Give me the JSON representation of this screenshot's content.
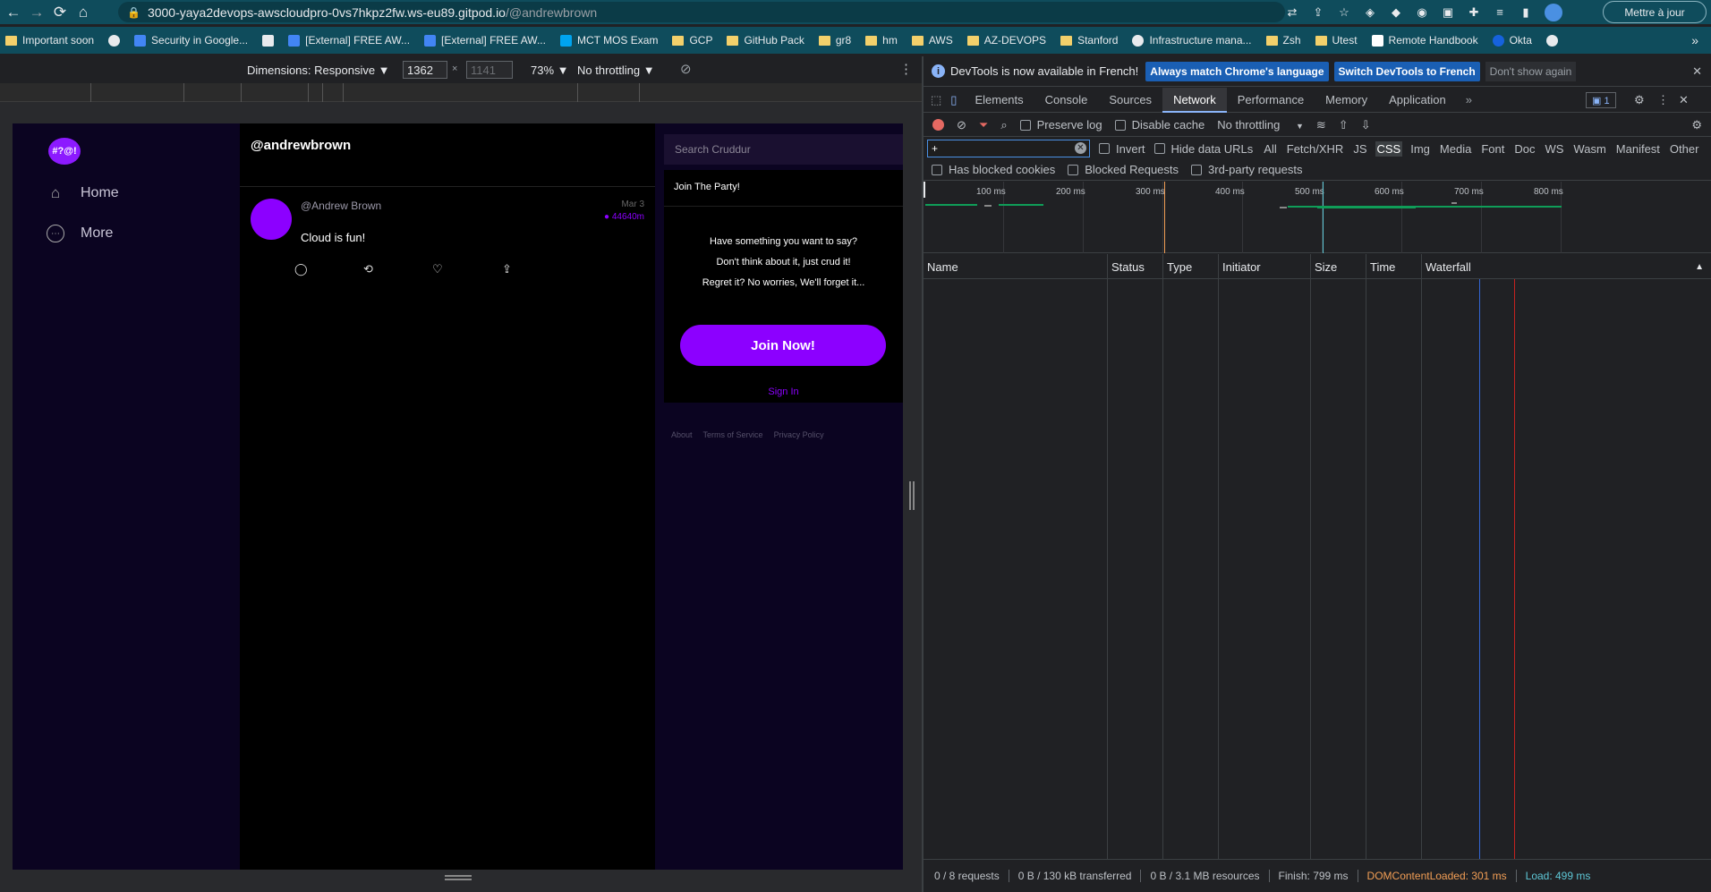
{
  "browser": {
    "url_host": "3000-yaya2devops-awscloudpro-0vs7hkpz2fw.ws-eu89.gitpod.io",
    "url_path": "/@andrewbrown",
    "update_button": "Mettre à jour",
    "bookmarks": [
      {
        "label": "Important soon",
        "icon": "folder"
      },
      {
        "label": "",
        "icon": "globe"
      },
      {
        "label": "Security in Google...",
        "icon": "gcloud"
      },
      {
        "label": "",
        "icon": "doc"
      },
      {
        "label": "[External] FREE AW...",
        "icon": "gdoc"
      },
      {
        "label": "[External] FREE AW...",
        "icon": "gdoc"
      },
      {
        "label": "MCT MOS Exam",
        "icon": "ms"
      },
      {
        "label": "GCP",
        "icon": "folder"
      },
      {
        "label": "GitHub Pack",
        "icon": "folder"
      },
      {
        "label": "gr8",
        "icon": "folder"
      },
      {
        "label": "hm",
        "icon": "folder"
      },
      {
        "label": "AWS",
        "icon": "folder"
      },
      {
        "label": "AZ-DEVOPS",
        "icon": "folder"
      },
      {
        "label": "Stanford",
        "icon": "folder"
      },
      {
        "label": "Infrastructure mana...",
        "icon": "globe"
      },
      {
        "label": "Zsh",
        "icon": "folder"
      },
      {
        "label": "Utest",
        "icon": "folder"
      },
      {
        "label": "Remote Handbook",
        "icon": "notion"
      },
      {
        "label": "Okta",
        "icon": "okta"
      },
      {
        "label": "",
        "icon": "github"
      }
    ],
    "bookmarks_more": "»"
  },
  "device_toolbar": {
    "dimensions_label": "Dimensions: Responsive ▼",
    "width": "1362",
    "height": "1141",
    "times": "×",
    "zoom": "73% ▼",
    "throttle": "No throttling ▼"
  },
  "app": {
    "logo_text": "#?@!",
    "nav": [
      {
        "label": "Home",
        "icon": "home-icon"
      },
      {
        "label": "More",
        "icon": "more-icon"
      }
    ],
    "feed_title": "@andrewbrown",
    "post": {
      "handle": "@Andrew Brown",
      "date": "Mar 3",
      "expiry": "44640m",
      "text": "Cloud is fun!"
    },
    "search_placeholder": "Search Cruddur",
    "join": {
      "title": "Join The Party!",
      "lines": [
        "Have something you want to say?",
        "Don't think about it, just crud it!",
        "Regret it? No worries, We'll forget it..."
      ],
      "button": "Join Now!",
      "signin": "Sign In"
    },
    "footer_links": [
      "About",
      "Terms of Service",
      "Privacy Policy"
    ],
    "accent": "#8c00ff"
  },
  "devtools": {
    "info_text": "DevTools is now available in French!",
    "info_btn_match": "Always match Chrome's language",
    "info_btn_switch": "Switch DevTools to French",
    "info_btn_dismiss": "Don't show again",
    "tabs": [
      "Elements",
      "Console",
      "Sources",
      "Network",
      "Performance",
      "Memory",
      "Application"
    ],
    "active_tab": "Network",
    "issues_count": "1",
    "preserve_log": "Preserve log",
    "disable_cache": "Disable cache",
    "throttling": "No throttling",
    "filter_value": "+",
    "invert": "Invert",
    "hide_data_urls": "Hide data URLs",
    "filter_types": [
      "All",
      "Fetch/XHR",
      "JS",
      "CSS",
      "Img",
      "Media",
      "Font",
      "Doc",
      "WS",
      "Wasm",
      "Manifest",
      "Other"
    ],
    "selected_type": "CSS",
    "has_blocked_cookies": "Has blocked cookies",
    "blocked_requests": "Blocked Requests",
    "third_party": "3rd-party requests",
    "timeline_ticks": [
      "100 ms",
      "200 ms",
      "300 ms",
      "400 ms",
      "500 ms",
      "600 ms",
      "700 ms",
      "800 ms"
    ],
    "columns": [
      "Name",
      "Status",
      "Type",
      "Initiator",
      "Size",
      "Time",
      "Waterfall"
    ],
    "status": {
      "requests": "0 / 8 requests",
      "transferred": "0 B / 130 kB transferred",
      "resources": "0 B / 3.1 MB resources",
      "finish": "Finish: 799 ms",
      "dcl": "DOMContentLoaded: 301 ms",
      "load": "Load: 499 ms"
    },
    "colors": {
      "dcl": "#f29e55",
      "load": "#5ec7d6",
      "active_tab_underline": "#8ab4f8"
    }
  }
}
